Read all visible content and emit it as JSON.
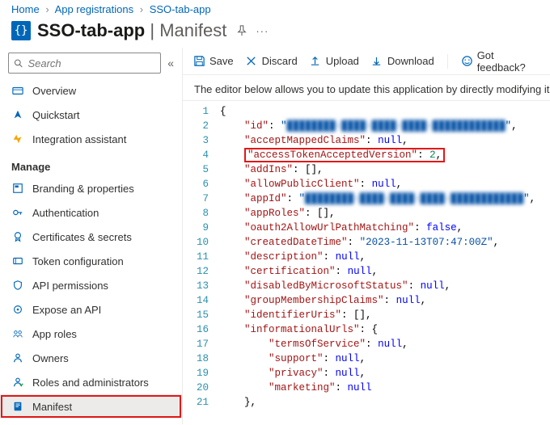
{
  "breadcrumb": {
    "home": "Home",
    "appreg": "App registrations",
    "app": "SSO-tab-app"
  },
  "header": {
    "title": "SSO-tab-app",
    "subtitle": "Manifest"
  },
  "search": {
    "placeholder": "Search"
  },
  "nav_top": {
    "overview": "Overview",
    "quickstart": "Quickstart",
    "integration": "Integration assistant"
  },
  "section_manage": "Manage",
  "nav_manage": {
    "branding": "Branding & properties",
    "auth": "Authentication",
    "certs": "Certificates & secrets",
    "tokenconf": "Token configuration",
    "apiperm": "API permissions",
    "exposeapi": "Expose an API",
    "approles": "App roles",
    "owners": "Owners",
    "rolesadmins": "Roles and administrators",
    "manifest": "Manifest"
  },
  "toolbar": {
    "save": "Save",
    "discard": "Discard",
    "upload": "Upload",
    "download": "Download",
    "feedback": "Got feedback?"
  },
  "description": "The editor below allows you to update this application by directly modifying its JS",
  "manifest": {
    "id_key": "id",
    "id_value": "████████-████-████-████-████████████",
    "acceptMappedClaims_key": "acceptMappedClaims",
    "acceptMappedClaims_value": "null",
    "accessTokenAcceptedVersion_key": "accessTokenAcceptedVersion",
    "accessTokenAcceptedVersion_value": "2",
    "addIns_key": "addIns",
    "allowPublicClient_key": "allowPublicClient",
    "allowPublicClient_value": "null",
    "appId_key": "appId",
    "appId_value": "████████-████-████-████-████████████",
    "appRoles_key": "appRoles",
    "oauth2AllowUrlPathMatching_key": "oauth2AllowUrlPathMatching",
    "oauth2AllowUrlPathMatching_value": "false",
    "createdDateTime_key": "createdDateTime",
    "createdDateTime_value": "2023-11-13T07:47:00Z",
    "description_key": "description",
    "description_value": "null",
    "certification_key": "certification",
    "certification_value": "null",
    "disabledByMicrosoftStatus_key": "disabledByMicrosoftStatus",
    "disabledByMicrosoftStatus_value": "null",
    "groupMembershipClaims_key": "groupMembershipClaims",
    "groupMembershipClaims_value": "null",
    "identifierUris_key": "identifierUris",
    "informationalUrls_key": "informationalUrls",
    "termsOfService_key": "termsOfService",
    "termsOfService_value": "null",
    "support_key": "support",
    "support_value": "null",
    "privacy_key": "privacy",
    "privacy_value": "null",
    "marketing_key": "marketing",
    "marketing_value": "null"
  },
  "line_numbers": [
    "1",
    "2",
    "3",
    "4",
    "5",
    "6",
    "7",
    "8",
    "9",
    "10",
    "11",
    "12",
    "13",
    "14",
    "15",
    "16",
    "17",
    "18",
    "19",
    "20",
    "21"
  ]
}
